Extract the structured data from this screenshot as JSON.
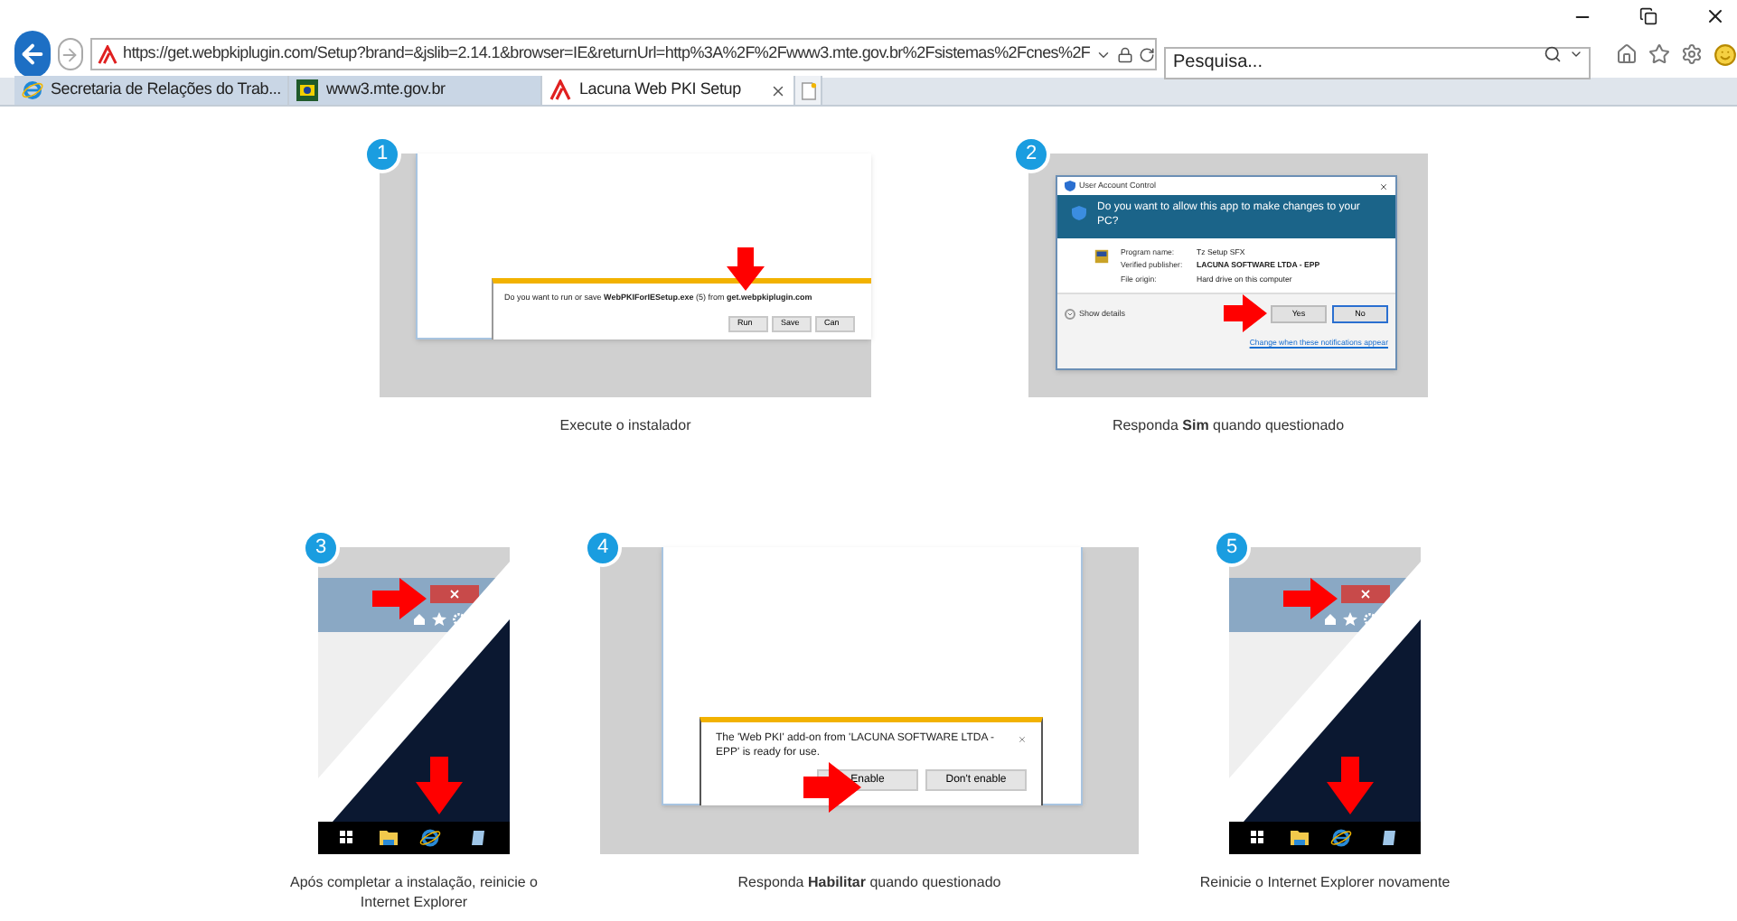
{
  "toolbar": {
    "url": "https://get.webpkiplugin.com/Setup?brand=&jslib=2.14.1&browser=IE&returnUrl=http%3A%2F%2Fwww3.mte.gov.br%2Fsistemas%2Fcnes%2F",
    "search": {
      "placeholder": "Pesquisa..."
    }
  },
  "tabs": [
    {
      "label": "Secretaria de Relações do Trab...",
      "kind": "ie",
      "selected": false
    },
    {
      "label": "www3.mte.gov.br",
      "kind": "site",
      "selected": false
    },
    {
      "label": "Lacuna Web PKI Setup",
      "kind": "lacuna",
      "selected": true
    }
  ],
  "rows": [
    {
      "steps": [
        {
          "number": "1",
          "kind": "download",
          "caption": "Execute o instalador",
          "screen": {
            "message": "Do you want to run or save **WebPKIForIESetup.exe** (5) from **get.webpkiplugin.com**",
            "buttons": [
              "Run",
              "Save",
              "Can"
            ]
          }
        },
        {
          "number": "2",
          "kind": "uac",
          "caption": "Responda **Sim** quando questionado",
          "screen": {
            "title": "User Account Control",
            "question": "Do you want to allow this app to make changes to your PC?",
            "fields": [
              {
                "label": "Program name:",
                "value": "Tz Setup SFX"
              },
              {
                "label": "Verified publisher:",
                "value": "LACUNA SOFTWARE LTDA - EPP"
              },
              {
                "label": "File origin:",
                "value": "Hard drive on this computer"
              }
            ],
            "details": "Show details",
            "buttons": [
              "Yes",
              "No"
            ],
            "link": "Change when these notifications appear"
          }
        }
      ]
    },
    {
      "steps": [
        {
          "number": "3",
          "kind": "restart",
          "caption": "Após completar a instalação, reinicie o Internet Explorer"
        },
        {
          "number": "4",
          "kind": "addon",
          "caption": "Responda **Habilitar** quando questionado",
          "screen": {
            "message": "The 'Web PKI' add-on from 'LACUNA SOFTWARE LTDA - EPP' is ready for use.",
            "buttons": [
              "Enable",
              "Don't enable"
            ]
          }
        },
        {
          "number": "5",
          "kind": "restart",
          "caption": "Reinicie o Internet Explorer novamente"
        }
      ]
    }
  ]
}
